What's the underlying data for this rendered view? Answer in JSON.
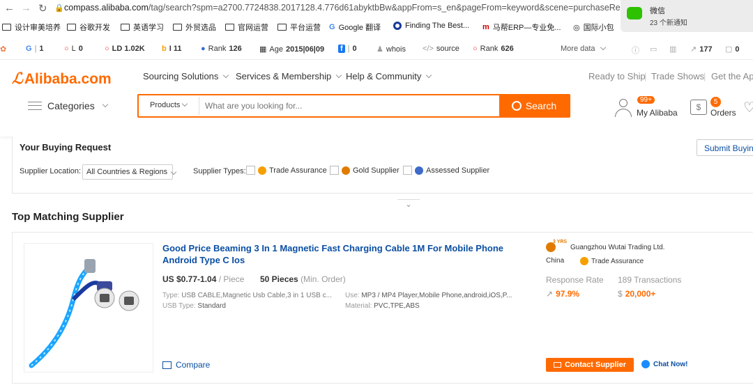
{
  "browser": {
    "url_host": "compass.alibaba.com",
    "url_path": "/tag/search?spm=a2700.7724838.2017128.4.776d61abyktbBw&appFrom=s_en&pageFrom=keyword&scene=purchaseRec"
  },
  "bookmarks": [
    "设计审美培养",
    "谷歌开发",
    "英语学习",
    "外贸选品",
    "官网运营",
    "平台运营",
    "Google 翻译",
    "Finding The Best...",
    "马帮ERP—专业免...",
    "国际小包"
  ],
  "notification": {
    "title": "微信",
    "text": "23 个新通知"
  },
  "seo_bar": {
    "g": "1",
    "l": "0",
    "ld": "LD 1.02K",
    "b": "I 11",
    "rank_label": "Rank",
    "rank_value": "126",
    "age_label": "Age",
    "age_value": "2015|06|09",
    "fb": "0",
    "whois": "whois",
    "source": "source",
    "rank2_label": "Rank",
    "rank2_value": "626",
    "more": "More data",
    "links": "177",
    "zero": "0"
  },
  "header": {
    "logo": "Alibaba.com",
    "nav": [
      "Sourcing Solutions",
      "Services & Membership",
      "Help & Community"
    ],
    "right_nav": [
      "Ready to Ship",
      "Trade Shows",
      "Get the App"
    ],
    "categories": "Categories",
    "search_scope": "Products",
    "search_placeholder": "What are you looking for...",
    "search_button": "Search",
    "my_alibaba": "My Alibaba",
    "my_alibaba_badge": "99+",
    "orders": "Orders",
    "orders_badge": "5"
  },
  "buying_request": {
    "title": "Your Buying Request",
    "submit": "Submit Buying Request",
    "location_label": "Supplier Location:",
    "location_value": "All Countries & Regions",
    "types_label": "Supplier Types:",
    "types": [
      "Trade Assurance",
      "Gold Supplier",
      "Assessed Supplier"
    ]
  },
  "results": {
    "heading": "Top Matching Supplier",
    "product": {
      "title": "Good Price Beaming 3 In 1 Magnetic Fast Charging Cable 1M For Mobile Phone Android Type C Ios",
      "price": "US $0.77-1.04",
      "price_unit": "/ Piece",
      "moq": "50 Pieces",
      "moq_note": "(Min. Order)",
      "type_label": "Type:",
      "type_value": "USB CABLE,Magnetic Usb Cable,3 in 1 USB c...",
      "use_label": "Use:",
      "use_value": "MP3 / MP4 Player,Mobile Phone,android,iOS,P...",
      "usb_label": "USB Type:",
      "usb_value": "Standard",
      "material_label": "Material:",
      "material_value": "PVC,TPE,ABS",
      "compare": "Compare"
    },
    "supplier": {
      "years": "3 YRS",
      "name": "Guangzhou Wutai Trading Ltd.",
      "country": "China",
      "trade_assurance": "Trade Assurance",
      "response_label": "Response Rate",
      "response_value": "97.9%",
      "transactions_label": "189 Transactions",
      "transactions_value": "20,000+",
      "contact": "Contact Supplier",
      "chat": "Chat Now!"
    }
  },
  "colors": {
    "brand": "#ff6a00",
    "link": "#0b4fa3"
  }
}
